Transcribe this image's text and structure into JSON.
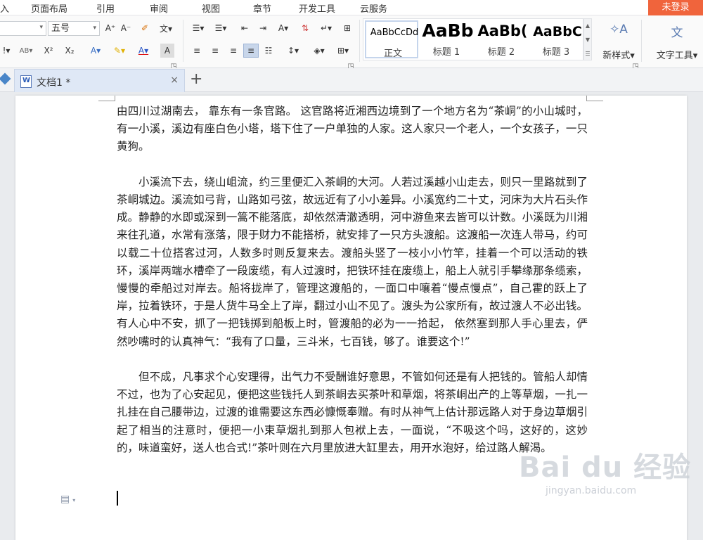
{
  "menu": {
    "items": [
      "入",
      "页面布局",
      "引用",
      "审阅",
      "视图",
      "章节",
      "开发工具",
      "云服务"
    ],
    "login": "未登录"
  },
  "ribbon": {
    "font_size": "五号",
    "grow_font": "A⁺",
    "shrink_font": "A⁻",
    "superscript": "X²",
    "subscript": "X₂",
    "styles": [
      {
        "sample": "AaBbCcDd",
        "name": "正文"
      },
      {
        "sample": "AaBb",
        "name": "标题 1"
      },
      {
        "sample": "AaBb(",
        "name": "标题 2"
      },
      {
        "sample": "AaBbC",
        "name": "标题 3"
      }
    ],
    "new_style": "新样式",
    "text_tools": "文字工具"
  },
  "tabs": {
    "doc_title": "文档1 *",
    "close": "×",
    "add": "+"
  },
  "document": {
    "paragraphs": [
      "由四川过湖南去， 靠东有一条官路。 这官路将近湘西边境到了一个地方名为“茶峒”的小山城时，有一小溪，溪边有座白色小塔，塔下住了一户单独的人家。这人家只一个老人，一个女孩子，一只黄狗。",
      "小溪流下去，绕山岨流，约三里便汇入茶峒的大河。人若过溪越小山走去，则只一里路就到了茶峒城边。溪流如弓背，山路如弓弦，故远近有了小小差异。小溪宽约二十丈，河床为大片石头作成。静静的水即或深到一篙不能落底，却依然清澈透明，河中游鱼来去皆可以计数。小溪既为川湘来往孔道，水常有涨落，限于财力不能搭桥，就安排了一只方头渡船。这渡船一次连人带马，约可以载二十位搭客过河，人数多时则反复来去。渡船头竖了一枝小小竹竿，挂着一个可以活动的铁环，溪岸两端水槽牵了一段废缆，有人过渡时，把铁环挂在废缆上，船上人就引手攀缘那条缆索，慢慢的牵船过对岸去。船将拢岸了，管理这渡船的，一面口中嚷着“慢点慢点”，自己霍的跃上了岸，拉着铁环，于是人货牛马全上了岸，翻过小山不见了。渡头为公家所有，故过渡人不必出钱。有人心中不安，抓了一把钱掷到船板上时，管渡船的必为一一拾起， 依然塞到那人手心里去，俨然吵嘴时的认真神气：“我有了口量，三斗米，七百钱，够了。谁要这个!”",
      "但不成，凡事求个心安理得，出气力不受酬谁好意思，不管如何还是有人把钱的。管船人却情不过，也为了心安起见，便把这些钱托人到茶峒去买茶叶和草烟，将茶峒出产的上等草烟，一扎一扎挂在自己腰带边，过渡的谁需要这东西必慷慨奉赠。有时从神气上估计那远路人对于身边草烟引起了相当的注意时，便把一小束草烟扎到那人包袱上去，一面说，“不吸这个吗，这好的，这妙的，味道蛮好，送人也合式!”茶叶则在六月里放进大缸里去，用开水泡好，给过路人解渴。"
    ]
  },
  "watermark": {
    "logo": "Bai du 经验",
    "url": "jingyan.baidu.com"
  }
}
